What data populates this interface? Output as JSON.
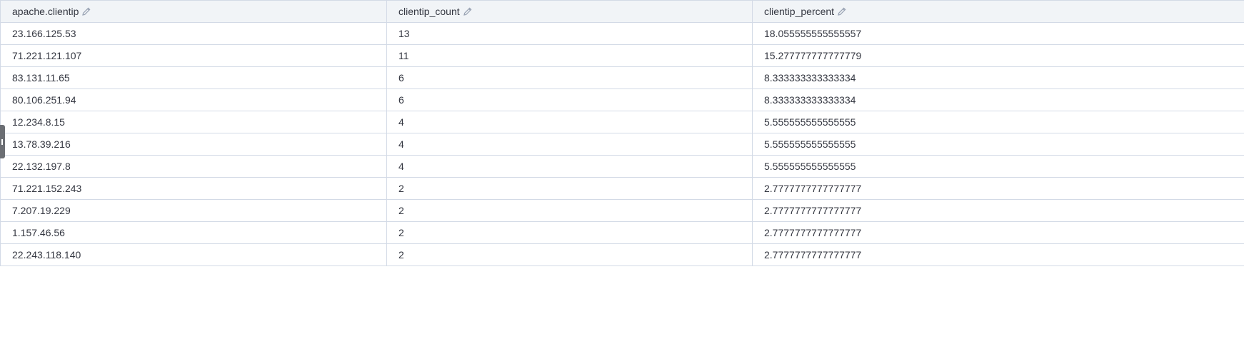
{
  "table": {
    "columns": [
      {
        "label": "apache.clientip",
        "icon": "pencil-icon"
      },
      {
        "label": "clientip_count",
        "icon": "pencil-icon"
      },
      {
        "label": "clientip_percent",
        "icon": "pencil-icon"
      }
    ],
    "rows": [
      {
        "clientip": "23.166.125.53",
        "count": "13",
        "percent": "18.055555555555557"
      },
      {
        "clientip": "71.221.121.107",
        "count": "11",
        "percent": "15.277777777777779"
      },
      {
        "clientip": "83.131.11.65",
        "count": "6",
        "percent": "8.333333333333334"
      },
      {
        "clientip": "80.106.251.94",
        "count": "6",
        "percent": "8.333333333333334"
      },
      {
        "clientip": "12.234.8.15",
        "count": "4",
        "percent": "5.555555555555555"
      },
      {
        "clientip": "13.78.39.216",
        "count": "4",
        "percent": "5.555555555555555"
      },
      {
        "clientip": "22.132.197.8",
        "count": "4",
        "percent": "5.555555555555555"
      },
      {
        "clientip": "71.221.152.243",
        "count": "2",
        "percent": "2.7777777777777777"
      },
      {
        "clientip": "7.207.19.229",
        "count": "2",
        "percent": "2.7777777777777777"
      },
      {
        "clientip": "1.157.46.56",
        "count": "2",
        "percent": "2.7777777777777777"
      },
      {
        "clientip": "22.243.118.140",
        "count": "2",
        "percent": "2.7777777777777777"
      }
    ]
  },
  "colors": {
    "header_bg": "#f1f4f7",
    "border": "#d3dae6",
    "text": "#343741",
    "icon": "#98a2b3"
  }
}
